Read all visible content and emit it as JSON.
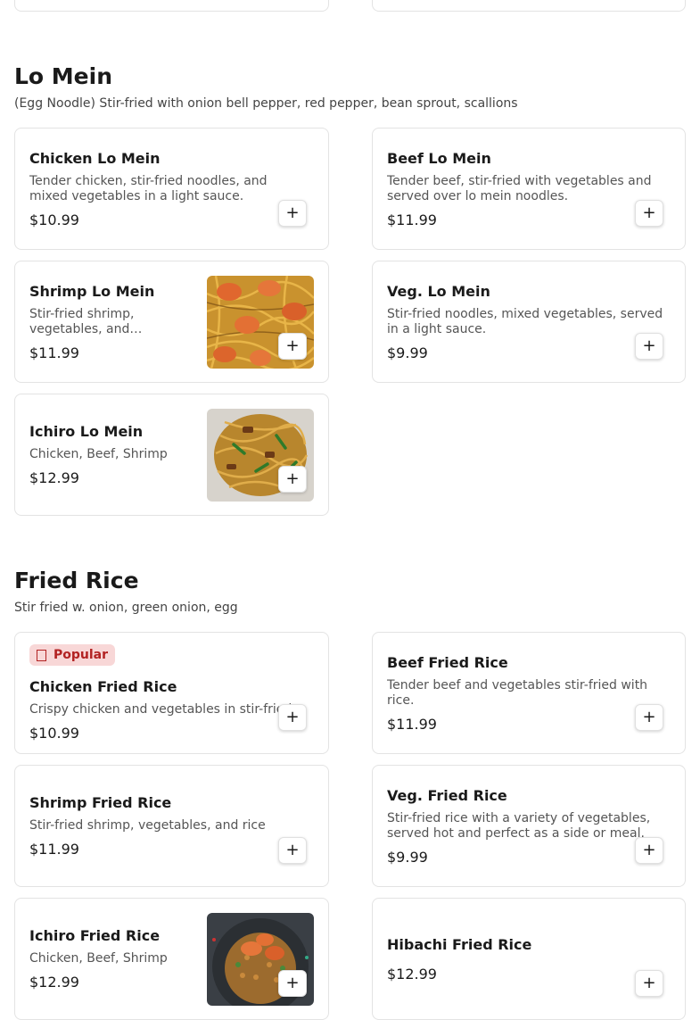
{
  "sections": [
    {
      "title": "Lo Mein",
      "description": "(Egg Noodle) Stir-fried with onion bell pepper, red pepper, bean sprout, scallions",
      "items": [
        {
          "name": "Chicken Lo Mein",
          "description": "Tender chicken, stir-fried noodles, and mixed vegetables in a light sauce.",
          "price": "$10.99"
        },
        {
          "name": "Beef Lo Mein",
          "description": "Tender beef, stir-fried with vegetables and served over lo mein noodles.",
          "price": "$11.99"
        },
        {
          "name": "Shrimp Lo Mein",
          "description": "Stir-fried shrimp, vegetables, and…",
          "price": "$11.99"
        },
        {
          "name": "Veg. Lo Mein",
          "description": "Stir-fried noodles, mixed vegetables, served in a light sauce.",
          "price": "$9.99"
        },
        {
          "name": "Ichiro Lo Mein",
          "description": "Chicken, Beef, Shrimp",
          "price": "$12.99"
        }
      ]
    },
    {
      "title": "Fried Rice",
      "description": "Stir fried w. onion, green onion, egg",
      "items": [
        {
          "name": "Chicken Fried Rice",
          "badge": "Popular",
          "description": "Crispy chicken and vegetables in stir-fried rice.",
          "price": "$10.99"
        },
        {
          "name": "Beef Fried Rice",
          "description": "Tender beef and vegetables stir-fried with rice.",
          "price": "$11.99"
        },
        {
          "name": "Shrimp Fried Rice",
          "description": "Stir-fried shrimp, vegetables, and rice",
          "price": "$11.99"
        },
        {
          "name": "Veg. Fried Rice",
          "description": "Stir-fried rice with a variety of vegetables, served hot and perfect as a side or meal.",
          "price": "$9.99"
        },
        {
          "name": "Ichiro Fried Rice",
          "description": "Chicken, Beef, Shrimp",
          "price": "$12.99"
        },
        {
          "name": "Hibachi Fried Rice",
          "description": "",
          "price": "$12.99"
        }
      ]
    }
  ],
  "add_button_glyph": "+",
  "icons": {
    "badge": "fire-icon",
    "add": "plus-icon"
  },
  "colors": {
    "badge_bg": "#f8d7d7",
    "badge_text": "#b22222",
    "border": "#e3e3e3"
  }
}
